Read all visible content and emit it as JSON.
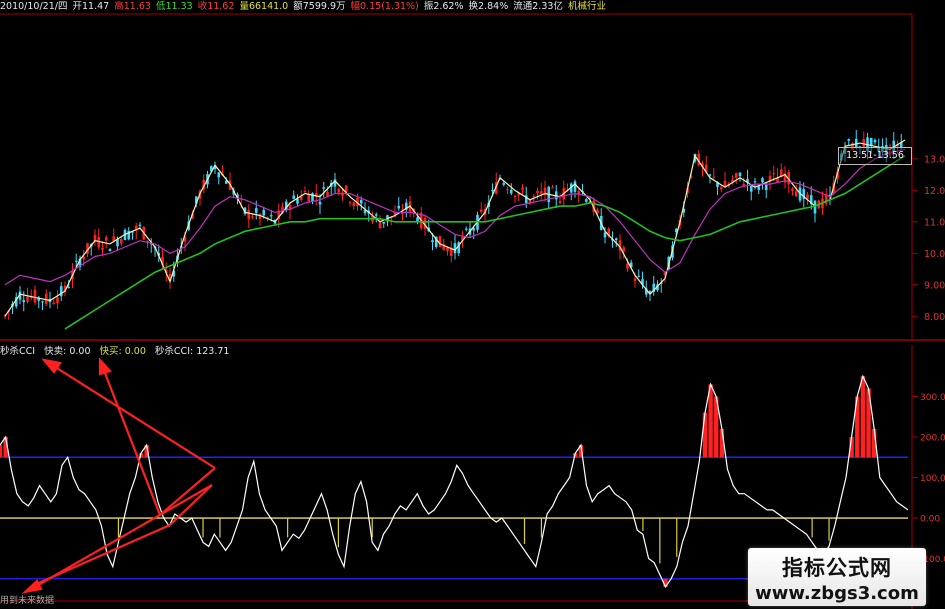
{
  "info_bar": {
    "date": "2010/10/21/四",
    "open": "开11.47",
    "high": "高11.63",
    "low": "低11.33",
    "close": "收11.62",
    "volume": "量66141.0",
    "amount": "额7599.9万",
    "change": "幅0.15(1.31%)",
    "amplitude": "振2.62%",
    "turnover": "换2.84%",
    "float_shares": "流通2.33亿",
    "industry": "机械行业"
  },
  "price_box": "13.51-13.56",
  "price_axis": [
    "13.00",
    "12.00",
    "11.00",
    "10.00",
    "9.00",
    "8.00"
  ],
  "cci_legend": {
    "name": "秒杀CCI",
    "quick_sell": "快卖: 0.00",
    "quick_buy": "快买: 0.00",
    "value": "秒杀CCI: 123.71"
  },
  "cci_axis": [
    "300.00",
    "200.00",
    "100.00",
    "0.00",
    "-100.00"
  ],
  "bottom_label": "用到未来数据",
  "watermark": {
    "title": "指标公式网",
    "url": "www.zbgs3.com"
  },
  "colors": {
    "up": "#ff2020",
    "down": "#40d8ff",
    "ma_long": "#20c020",
    "ma_mid": "#c030c0",
    "cci_line": "#ffffff",
    "level_line": "#2020ff",
    "zero_line": "#e8e060",
    "arrow": "#ff2020"
  },
  "chart_data": [
    {
      "type": "line",
      "description_series": [
        "price"
      ],
      "ylim": [
        7.5,
        13.6
      ],
      "x": [
        0,
        15,
        30,
        45,
        60,
        75,
        90,
        105,
        120,
        135,
        150,
        165,
        180,
        195,
        210,
        225,
        240,
        255,
        270,
        285,
        300,
        315,
        330,
        345,
        360,
        375,
        390,
        405,
        420,
        435,
        450,
        465,
        480,
        495,
        510,
        525,
        540,
        555,
        570,
        585,
        600,
        615,
        630,
        645,
        660,
        675,
        690,
        705,
        720,
        735,
        750,
        765,
        780,
        795,
        810,
        825,
        840,
        855,
        870,
        885,
        900
      ],
      "series": [
        {
          "values": [
            8.0,
            8.7,
            8.6,
            8.5,
            8.8,
            9.8,
            10.4,
            10.3,
            10.6,
            10.8,
            10.2,
            9.1,
            10.6,
            11.9,
            12.8,
            12.2,
            11.3,
            11.2,
            11.0,
            11.6,
            11.9,
            11.8,
            12.3,
            11.8,
            11.4,
            11.0,
            11.2,
            11.5,
            10.9,
            10.3,
            10.1,
            10.7,
            11.3,
            12.4,
            12.0,
            11.7,
            11.9,
            11.8,
            12.2,
            11.7,
            10.7,
            10.2,
            9.3,
            8.7,
            9.2,
            11.0,
            13.1,
            12.4,
            12.1,
            12.4,
            12.1,
            12.3,
            12.5,
            11.9,
            11.5,
            11.7,
            13.4,
            13.5,
            13.4,
            13.3,
            13.6
          ]
        },
        {
          "values": [
            9.0,
            9.3,
            9.2,
            9.1,
            9.3,
            9.6,
            9.9,
            10.0,
            10.2,
            10.4,
            10.3,
            10.0,
            10.2,
            10.8,
            11.5,
            11.8,
            11.7,
            11.5,
            11.3,
            11.4,
            11.6,
            11.7,
            11.9,
            11.9,
            11.7,
            11.5,
            11.3,
            11.3,
            11.2,
            10.9,
            10.6,
            10.5,
            10.7,
            11.2,
            11.5,
            11.6,
            11.7,
            11.8,
            11.9,
            11.8,
            11.5,
            11.0,
            10.4,
            9.8,
            9.4,
            9.7,
            10.6,
            11.4,
            11.9,
            12.1,
            12.2,
            12.2,
            12.3,
            12.2,
            12.0,
            11.8,
            12.2,
            12.7,
            13.0,
            13.2,
            13.3
          ]
        },
        {
          "values": [
            null,
            null,
            null,
            null,
            7.6,
            7.9,
            8.2,
            8.5,
            8.8,
            9.1,
            9.4,
            9.6,
            9.8,
            10.0,
            10.3,
            10.5,
            10.7,
            10.8,
            10.9,
            11.0,
            11.0,
            11.1,
            11.1,
            11.1,
            11.1,
            11.1,
            11.0,
            11.0,
            11.0,
            11.0,
            11.0,
            11.0,
            11.0,
            11.1,
            11.2,
            11.3,
            11.4,
            11.5,
            11.5,
            11.6,
            11.5,
            11.3,
            11.0,
            10.7,
            10.5,
            10.4,
            10.5,
            10.6,
            10.8,
            11.0,
            11.1,
            11.2,
            11.3,
            11.4,
            11.5,
            11.7,
            11.9,
            12.2,
            12.5,
            12.8,
            13.1
          ]
        }
      ]
    },
    {
      "type": "line",
      "ylim": [
        -190,
        390
      ],
      "levels": [
        150,
        0,
        -150
      ],
      "x": [
        0,
        8,
        16,
        24,
        32,
        40,
        48,
        56,
        64,
        72,
        80,
        88,
        96,
        104,
        112,
        120,
        128,
        136,
        144,
        152,
        160,
        168,
        176,
        184,
        192,
        200,
        208,
        216,
        224,
        232,
        240,
        248,
        256,
        264,
        272,
        280,
        288,
        296,
        304,
        312,
        320,
        328,
        336,
        344,
        352,
        360,
        368,
        376,
        384,
        392,
        400,
        408,
        416,
        424,
        432,
        440,
        448,
        456,
        464,
        472,
        480,
        488,
        496,
        504,
        512,
        520,
        528,
        536,
        544,
        552,
        560,
        568,
        576,
        584,
        592,
        600,
        608,
        616,
        624,
        632,
        640,
        648,
        656,
        664,
        672,
        680,
        688,
        696,
        704,
        712,
        720,
        728,
        736,
        744,
        752,
        760,
        768,
        776,
        784,
        792,
        800,
        808,
        816,
        824,
        832,
        840,
        848,
        856,
        864,
        872,
        880,
        888,
        896,
        904,
        908
      ],
      "series": [
        {
          "name": "秒杀CCI",
          "values": [
            180,
            200,
            120,
            60,
            40,
            30,
            50,
            80,
            60,
            40,
            60,
            130,
            150,
            100,
            70,
            60,
            40,
            20,
            -20,
            -90,
            -120,
            -60,
            0,
            60,
            100,
            160,
            180,
            100,
            40,
            0,
            -20,
            10,
            0,
            -10,
            0,
            -30,
            -60,
            -70,
            -40,
            -60,
            -80,
            -60,
            -20,
            20,
            100,
            140,
            60,
            20,
            0,
            -20,
            -80,
            -60,
            -40,
            -50,
            -30,
            0,
            30,
            60,
            20,
            -40,
            -90,
            -120,
            -20,
            60,
            90,
            40,
            -60,
            -80,
            -40,
            -20,
            10,
            30,
            20,
            40,
            60,
            30,
            10,
            20,
            40,
            60,
            90,
            130,
            110,
            80,
            60,
            40,
            20,
            0,
            -10,
            0,
            -20,
            -40,
            -60,
            -80,
            -100,
            -120,
            -60,
            10,
            30,
            60,
            80,
            100,
            160,
            180,
            80,
            40,
            60,
            70,
            80,
            60,
            50,
            40,
            20,
            -30,
            -40,
            -100,
            -110,
            -140,
            -170,
            -150,
            -120,
            -60,
            -20,
            60,
            140,
            260,
            330,
            300,
            220,
            120,
            80,
            60,
            60,
            50,
            40,
            30,
            20,
            20,
            10,
            0,
            -10,
            -20,
            -30,
            -40,
            -60,
            -80,
            -90,
            -70,
            -20,
            40,
            100,
            200,
            300,
            350,
            320,
            220,
            100,
            80,
            60,
            40,
            30,
            20
          ]
        }
      ]
    }
  ]
}
